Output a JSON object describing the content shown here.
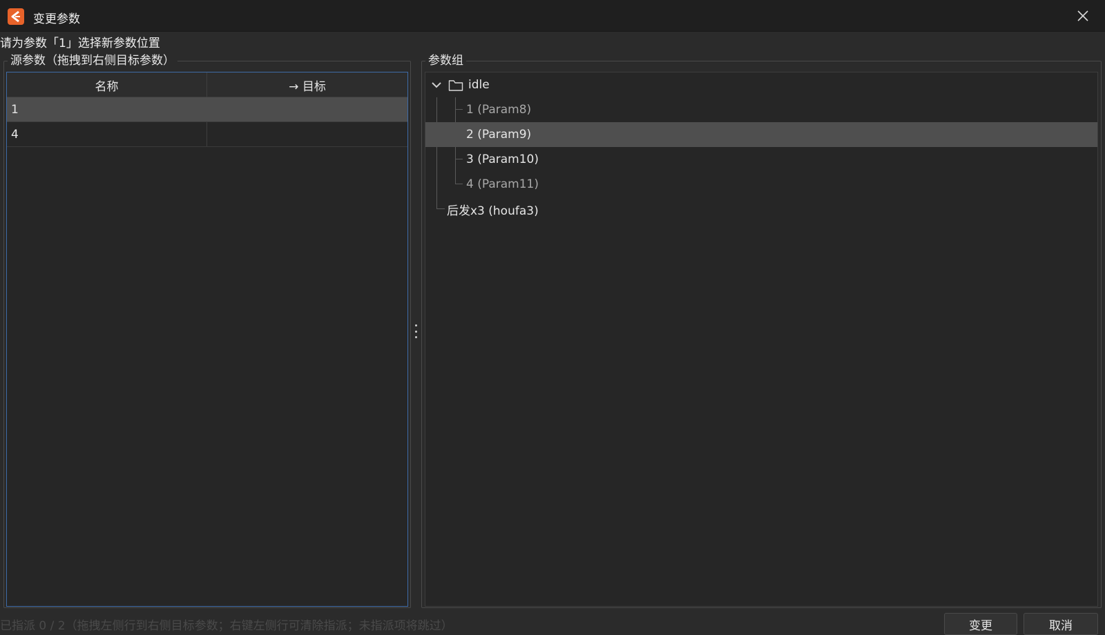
{
  "window": {
    "title": "变更参数"
  },
  "prompt": "请为参数「1」选择新参数位置",
  "source_panel": {
    "title": "源参数（拖拽到右侧目标参数）",
    "columns": [
      "名称",
      "→ 目标"
    ],
    "rows": [
      {
        "name": "1",
        "target": "",
        "selected": true
      },
      {
        "name": "4",
        "target": "",
        "selected": false
      }
    ]
  },
  "group_panel": {
    "title": "参数组",
    "tree": {
      "root_label": "idle",
      "children": [
        {
          "label": "1 (Param8)"
        },
        {
          "label": "2 (Param9)"
        },
        {
          "label": "3 (Param10)"
        },
        {
          "label": "4 (Param11)"
        }
      ],
      "sibling_label": "后发x3 (houfa3)"
    }
  },
  "status": {
    "text": "已指派 0 / 2（拖拽左侧行到右侧目标参数；右键左侧行可清除指派；未指派项将跳过）"
  },
  "buttons": {
    "change": "变更",
    "cancel": "取消"
  },
  "colors": {
    "background": "#2b2b2b",
    "titlebar": "#1f1f1f",
    "accent_icon": "#e8632a",
    "selection": "#4d4d4d",
    "focus_border": "#3e6ba8"
  }
}
